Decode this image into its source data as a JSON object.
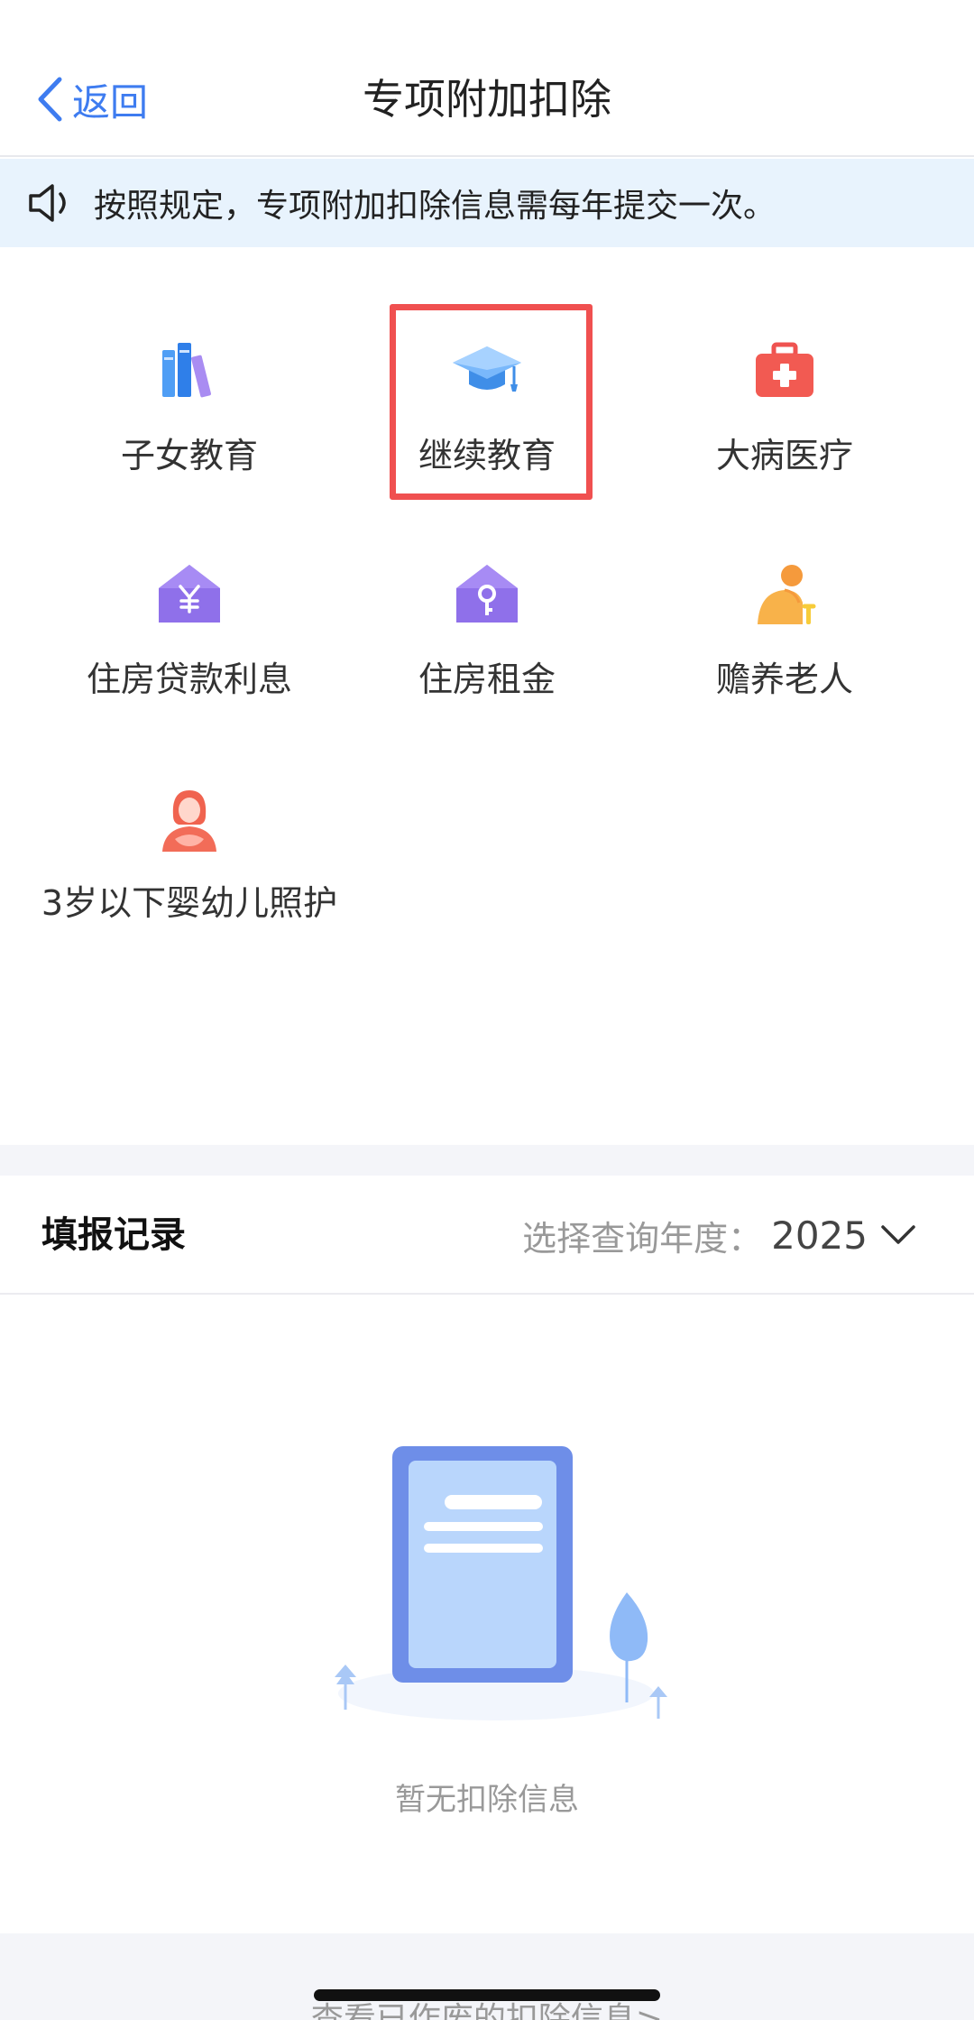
{
  "nav": {
    "back_label": "返回",
    "title": "专项附加扣除"
  },
  "notice": {
    "text": "按照规定，专项附加扣除信息需每年提交一次。"
  },
  "items": [
    {
      "label": "子女教育",
      "icon": "books-icon"
    },
    {
      "label": "继续教育",
      "icon": "graduation-cap-icon"
    },
    {
      "label": "大病医疗",
      "icon": "medical-kit-icon"
    },
    {
      "label": "住房贷款利息",
      "icon": "house-yen-icon"
    },
    {
      "label": "住房租金",
      "icon": "house-key-icon"
    },
    {
      "label": "赡养老人",
      "icon": "elderly-person-icon"
    },
    {
      "label": "3岁以下婴幼儿照护",
      "icon": "infant-care-icon"
    }
  ],
  "records": {
    "title": "填报记录",
    "year_label": "选择查询年度：",
    "year_value": "2025"
  },
  "empty": {
    "text": "暂无扣除信息"
  },
  "footer": {
    "link": "查看已作废的扣除信息>"
  },
  "colors": {
    "accent": "#3e7cf0",
    "highlight": "#f05050",
    "notice_bg": "#e8f3fd"
  }
}
